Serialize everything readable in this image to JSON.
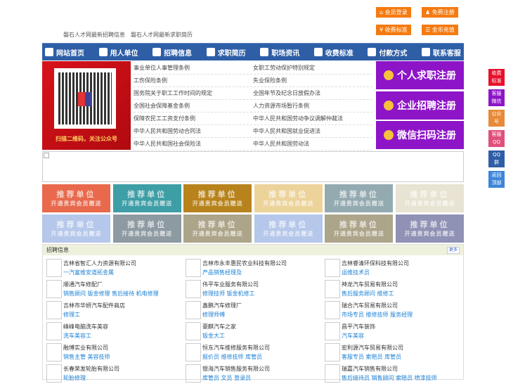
{
  "top_buttons": [
    "会员登录",
    "免费注册",
    "收费标准",
    "金币充值"
  ],
  "subtitle": [
    "磐石人才网最新招聘信息",
    "磐石人才网最新求职简历"
  ],
  "nav": [
    "网站首页",
    "用人单位",
    "招聘信息",
    "求职简历",
    "职场资讯",
    "收费标准",
    "付款方式",
    "联系客服"
  ],
  "qr_caption": "扫描二维码，关注公众号",
  "links": [
    [
      "事业单位人事管理条例",
      "女职工劳动保护特别规定"
    ],
    [
      "工伤保险条例",
      "失业保险条例"
    ],
    [
      "国务院关于职工工作时间的规定",
      "全国年节及纪念日放假办法"
    ],
    [
      "全国社会保障基金条例",
      "人力资源市场暂行条例"
    ],
    [
      "保障农民工工资支付条例",
      "中华人民共和国劳动争议调解仲裁法"
    ],
    [
      "中华人民共和国劳动合同法",
      "中华人民共和国就业促进法"
    ],
    [
      "中华人民共和国社会保险法",
      "中华人民共和国劳动法"
    ]
  ],
  "register": [
    "个人求职注册",
    "企业招聘注册",
    "微信扫码注册"
  ],
  "recommend": {
    "title": "推荐单位",
    "sub": "开通贵宾会员赠送",
    "colors": [
      "#e8694c",
      "#3e9ea6",
      "#b8831c",
      "#ecd39a",
      "#93aab0",
      "#e8e3d2",
      "#b5c7ea",
      "#8d9aa2",
      "#ada58a",
      "#b5c7ea",
      "#ada58a",
      "#8f92b4"
    ]
  },
  "recruit": {
    "title": "招聘信息",
    "more": "更多",
    "items": [
      [
        "吉林省智汇人力资源有限公司",
        "一汽富维安道拓金属"
      ],
      [
        "吉林市永丰惠民农业科技有限公司",
        "产品销售经理及"
      ],
      [
        "吉林睿清环保科技有限公司",
        "运维技术员"
      ],
      [
        "顺通汽车修配厂",
        "销售顾问 钣金修理 售后接待 机电修理"
      ],
      [
        "伟平车业服务有限公司",
        "修理技师 钣金机修工"
      ],
      [
        "神龙汽车贸易有限公司",
        "售后服务顾问 维修工"
      ],
      [
        "吉林市华妍汽车配件商店",
        "修理工"
      ],
      [
        "鑫鹏汽车修理厂",
        "修理师傅"
      ],
      [
        "瑞合汽车贸易有限公司",
        "市场专员 维修技师 服务经理"
      ],
      [
        "峰峰电脑洗车美容",
        "洗车美容工"
      ],
      [
        "豪麒汽车之家",
        "钣金大工"
      ],
      [
        "昌平汽车装饰",
        "汽车美容"
      ],
      [
        "融博实业有限公司",
        "销售主管 美容技师"
      ],
      [
        "恒东汽车维修服务有限公司",
        "报价员 维修技师 库管员"
      ],
      [
        "宏利源汽车贸易有限公司",
        "客服专员 索赔员 库管员"
      ],
      [
        "长春荣发轮胎有限公司",
        "轮胎修理"
      ],
      [
        "银海汽车销售服务有限公司",
        "库管员 文员 登录员"
      ],
      [
        "瑞嘉汽车销售有限公司",
        "售后接待员 销售顾问 索赔员 喷漆技师"
      ]
    ]
  },
  "side": [
    {
      "label": "收费标准",
      "color": "#e8102a"
    },
    {
      "label": "客服微信",
      "color": "#8e14c8"
    },
    {
      "label": "公众号",
      "color": "#e88a3a"
    },
    {
      "label": "客服QQ号",
      "color": "#e0507a"
    },
    {
      "label": "QQ群",
      "color": "#2e5ea6"
    },
    {
      "label": "返回顶部",
      "color": "#3d86d8"
    }
  ]
}
